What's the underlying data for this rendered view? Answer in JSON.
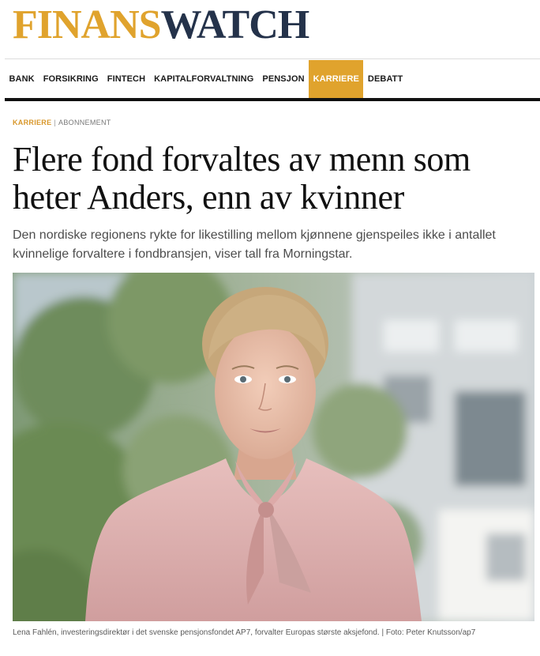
{
  "logo": {
    "part1": "FINANS",
    "part2": "WATCH"
  },
  "nav": {
    "items": [
      {
        "label": "BANK"
      },
      {
        "label": "FORSIKRING"
      },
      {
        "label": "FINTECH"
      },
      {
        "label": "KAPITALFORVALTNING"
      },
      {
        "label": "PENSJON"
      },
      {
        "label": "KARRIERE",
        "active": true
      },
      {
        "label": "DEBATT"
      }
    ]
  },
  "article": {
    "section": "KARRIERE",
    "separator": "|",
    "access": "ABONNEMENT",
    "headline": "Flere fond forvaltes av menn som heter Anders, enn av kvinner",
    "lead": "Den nordiske regionens rykte for likestilling mellom kjønnene gjenspeiles ikke i antallet kvinnelige forvaltere i fondbransjen, viser tall fra Morningstar.",
    "caption": "Lena Fahlén, investeringsdirektør i det svenske pensjonsfondet AP7, forvalter Europas største aksjefond. | Foto: Peter Knutsson/ap7"
  },
  "colors": {
    "accent": "#e0a32d",
    "brand_dark": "#24324a",
    "rule": "#111111"
  }
}
